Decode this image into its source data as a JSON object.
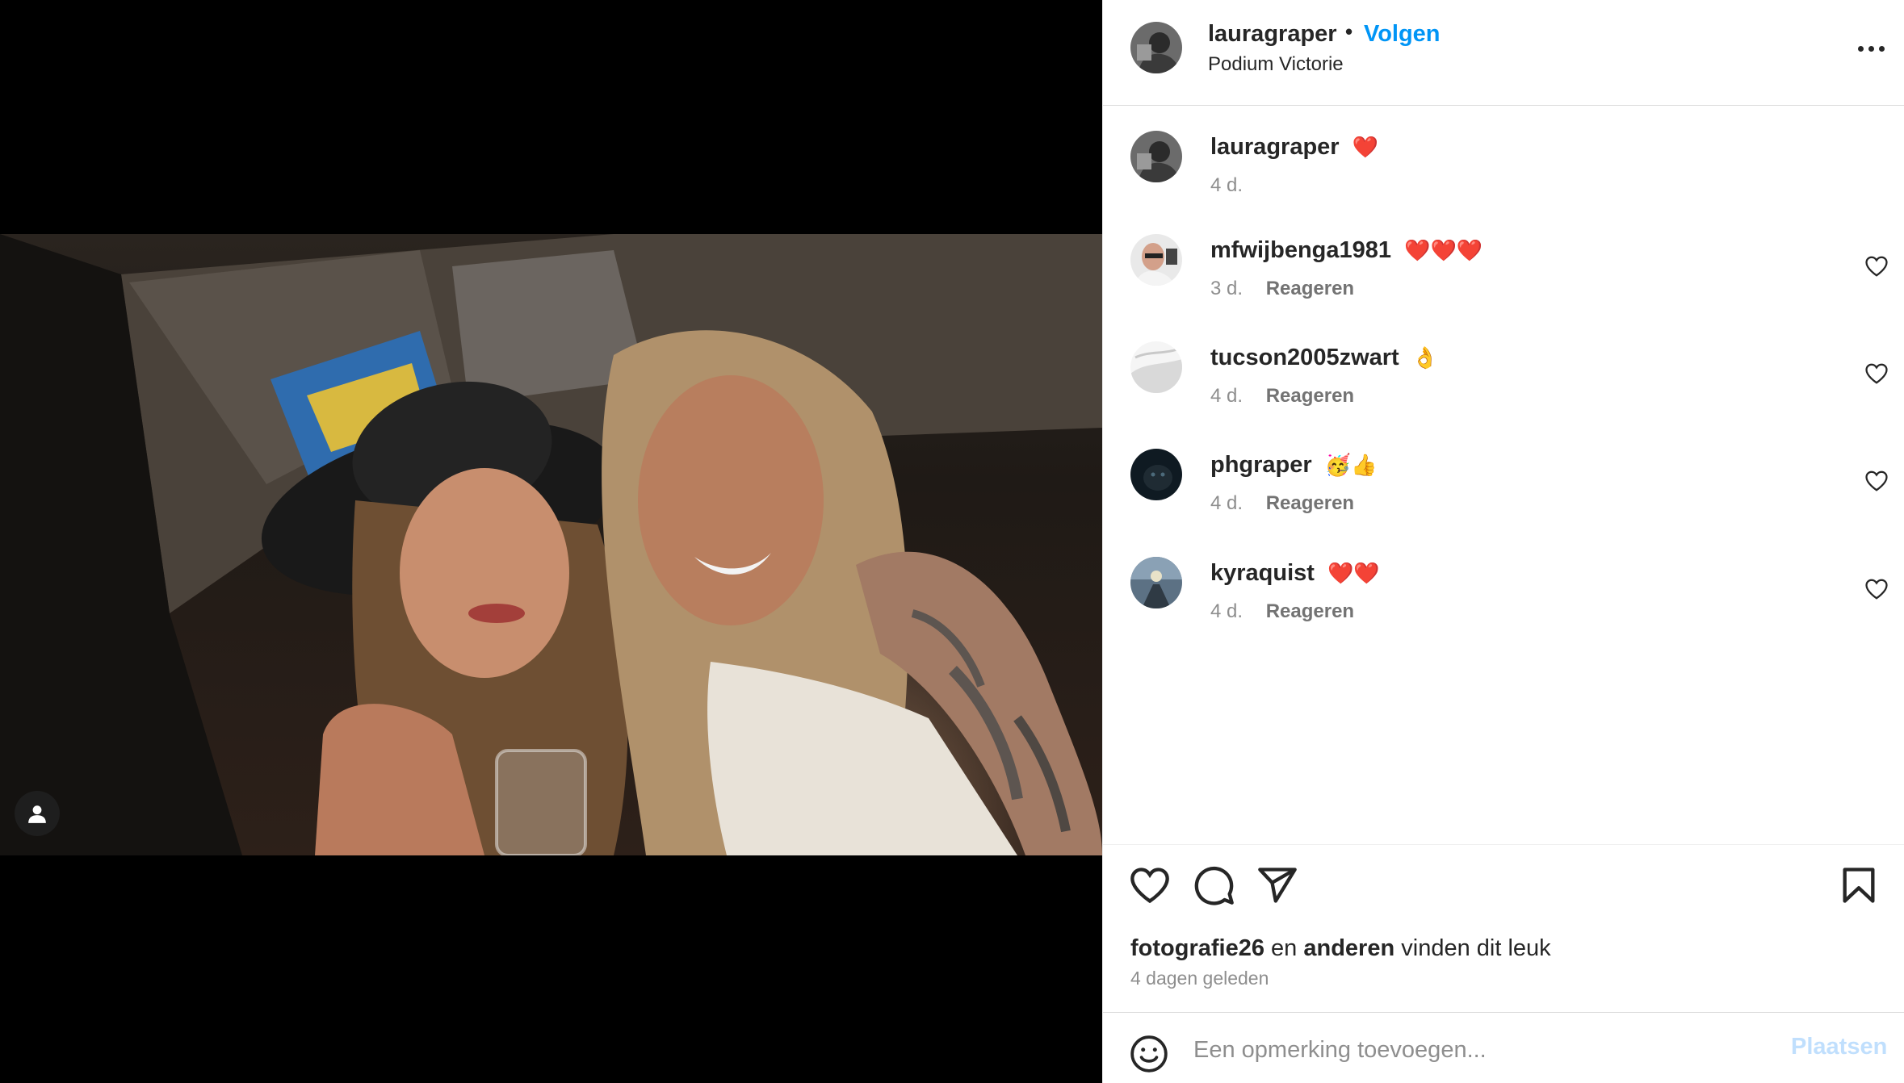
{
  "post": {
    "author": "lauragraper",
    "separator": "•",
    "follow_label": "Volgen",
    "location": "Podium Victorie",
    "more_icon": "more-horizontal-icon"
  },
  "media": {
    "tag_users_icon": "user-icon"
  },
  "comments": [
    {
      "username": "lauragraper",
      "text": "❤️",
      "time": "4 d.",
      "reply": ""
    },
    {
      "username": "mfwijbenga1981",
      "text": "❤️❤️❤️",
      "time": "3 d.",
      "reply": "Reageren"
    },
    {
      "username": "tucson2005zwart",
      "text": "👌",
      "time": "4 d.",
      "reply": "Reageren"
    },
    {
      "username": "phgraper",
      "text": "🥳👍",
      "time": "4 d.",
      "reply": "Reageren"
    },
    {
      "username": "kyraquist",
      "text": "❤️❤️",
      "time": "4 d.",
      "reply": "Reageren"
    }
  ],
  "actions": {
    "liked_by_user": "fotografie26",
    "liked_by_joiner": "en",
    "liked_by_others": "anderen",
    "liked_by_suffix": "vinden dit leuk",
    "time_ago": "4 dagen geleden"
  },
  "composer": {
    "placeholder": "Een opmerking toevoegen...",
    "post_label": "Plaatsen"
  },
  "colors": {
    "accent": "#0095f6",
    "post_disabled": "#c0dffd",
    "muted": "#8e8e8e",
    "heart": "#ed4956"
  }
}
